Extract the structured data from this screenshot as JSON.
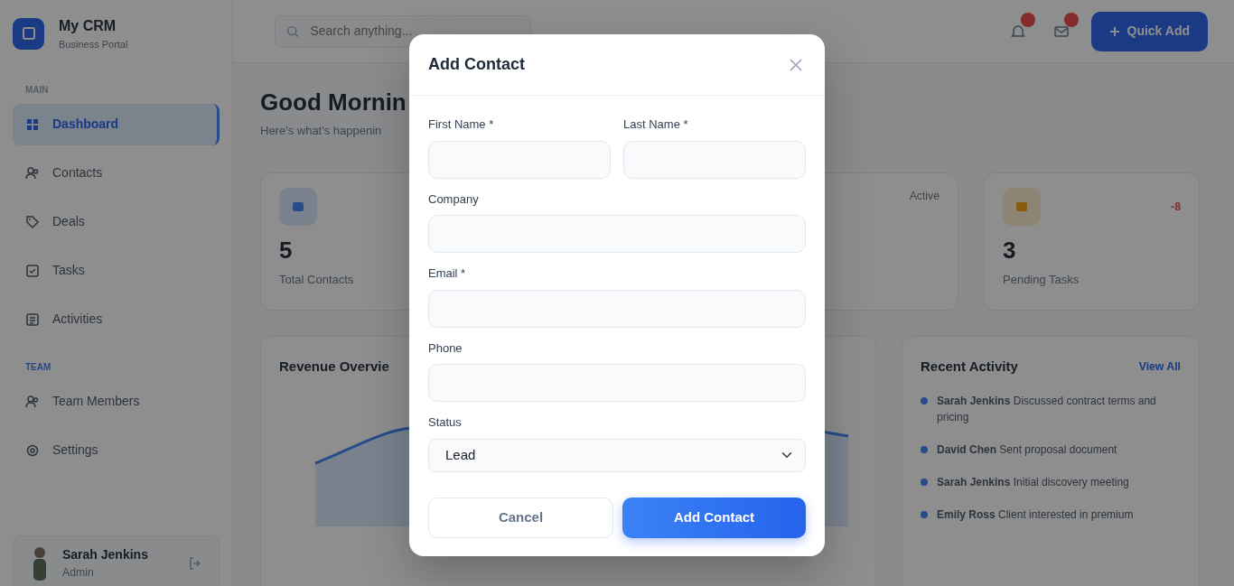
{
  "sidebar": {
    "brand": {
      "name": "My CRM",
      "subtitle": "Business Portal"
    },
    "sections": [
      {
        "label": "MAIN",
        "items": [
          {
            "label": "Dashboard",
            "selected": true
          },
          {
            "label": "Contacts",
            "selected": false
          },
          {
            "label": "Deals",
            "selected": false
          },
          {
            "label": "Tasks",
            "selected": false
          },
          {
            "label": "Activities",
            "selected": false
          }
        ]
      },
      {
        "label": "TEAM",
        "items": [
          {
            "label": "Team Members",
            "selected": false
          },
          {
            "label": "Settings",
            "selected": false
          }
        ]
      }
    ],
    "user": {
      "name": "Sarah Jenkins",
      "role": "Admin"
    }
  },
  "header": {
    "search": {
      "placeholder": "Search anything..."
    },
    "notifications": [
      {
        "kind": "bell"
      },
      {
        "kind": "mail"
      }
    ],
    "quick_add": "Quick Add"
  },
  "greeting": {
    "title": "Good Mornin",
    "subtitle": "Here's what's happenin"
  },
  "stats": [
    {
      "value": "5",
      "label": "Total Contacts"
    },
    {
      "badge": "Active"
    },
    {
      "value": "3",
      "label": "Pending Tasks",
      "trend": "-8"
    }
  ],
  "revenue": {
    "title": "Revenue Overvie"
  },
  "activity": {
    "title": "Recent Activity",
    "link": "View All",
    "items": [
      {
        "name": "Sarah Jenkins",
        "text": "Discussed contract terms and pricing"
      },
      {
        "name": "David Chen",
        "text": "Sent proposal document"
      },
      {
        "name": "Sarah Jenkins",
        "text": "Initial discovery meeting"
      },
      {
        "name": "Emily Ross",
        "text": "Client interested in premium"
      }
    ]
  },
  "modal": {
    "title": "Add Contact",
    "rows": [
      [
        {
          "label": "First Name *",
          "kind": "text"
        },
        {
          "label": "Last Name *",
          "kind": "text"
        }
      ],
      [
        {
          "label": "Company",
          "kind": "text"
        }
      ],
      [
        {
          "label": "Email *",
          "kind": "text"
        }
      ],
      [
        {
          "label": "Phone",
          "kind": "text"
        }
      ],
      [
        {
          "label": "Status",
          "kind": "select",
          "value": "Lead"
        }
      ]
    ],
    "buttons": [
      {
        "label": "Cancel",
        "kind": "secondary"
      },
      {
        "label": "Add Contact",
        "kind": "primary"
      }
    ]
  }
}
